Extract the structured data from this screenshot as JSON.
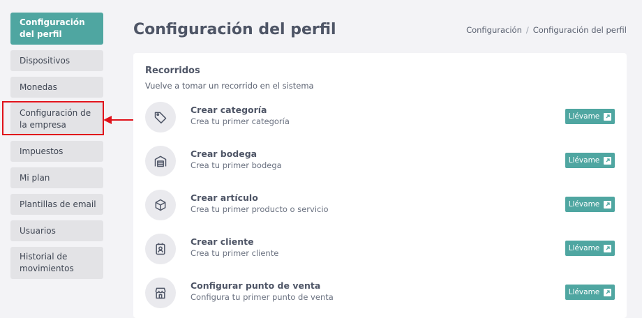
{
  "sidebar": {
    "items": [
      {
        "label": "Configuración del perfil"
      },
      {
        "label": "Dispositivos"
      },
      {
        "label": "Monedas"
      },
      {
        "label": "Configuración de la empresa"
      },
      {
        "label": "Impuestos"
      },
      {
        "label": "Mi plan"
      },
      {
        "label": "Plantillas de email"
      },
      {
        "label": "Usuarios"
      },
      {
        "label": "Historial de movimientos"
      }
    ]
  },
  "header": {
    "title": "Configuración del perfil",
    "breadcrumb": [
      "Configuración",
      "/",
      "Configuración del perfil"
    ]
  },
  "tours": {
    "title": "Recorridos",
    "subtitle": "Vuelve a tomar un recorrido en el sistema",
    "items": [
      {
        "title": "Crear categoría",
        "desc": "Crea tu primer categoría",
        "button": "Llévame",
        "icon": "tag-icon"
      },
      {
        "title": "Crear bodega",
        "desc": "Crea tu primer bodega",
        "button": "Llévame",
        "icon": "warehouse-icon"
      },
      {
        "title": "Crear artículo",
        "desc": "Crea tu primer producto o servicio",
        "button": "Llévame",
        "icon": "box-icon"
      },
      {
        "title": "Crear cliente",
        "desc": "Crea tu primer cliente",
        "button": "Llévame",
        "icon": "contact-icon"
      },
      {
        "title": "Configurar punto de venta",
        "desc": "Configura tu primer punto de venta",
        "button": "Llévame",
        "icon": "store-icon"
      }
    ]
  },
  "colors": {
    "accent": "#4fa6a1",
    "highlight": "#e0121a"
  }
}
